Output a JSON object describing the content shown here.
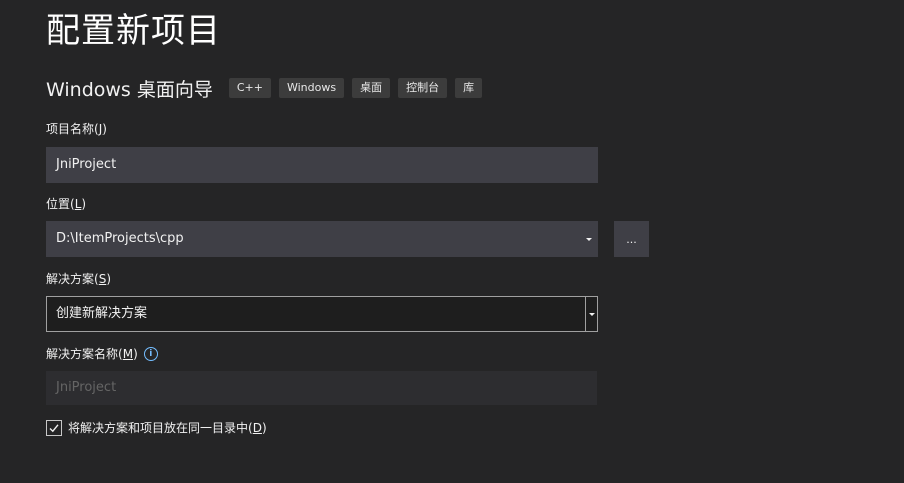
{
  "page": {
    "title": "配置新项目"
  },
  "template": {
    "name": "Windows 桌面向导",
    "tags": [
      "C++",
      "Windows",
      "桌面",
      "控制台",
      "库"
    ]
  },
  "project_name": {
    "label": "项目名称",
    "mnemonic": "J",
    "value": "JniProject"
  },
  "location": {
    "label": "位置",
    "mnemonic": "L",
    "value": "D:\\ItemProjects\\cpp",
    "browse_label": "..."
  },
  "solution": {
    "label": "解决方案",
    "mnemonic": "S",
    "selected": "创建新解决方案"
  },
  "solution_name": {
    "label": "解决方案名称",
    "mnemonic": "M",
    "value": "JniProject",
    "info_icon": "info-icon"
  },
  "same_dir": {
    "label": "将解决方案和项目放在同一目录中",
    "mnemonic": "D",
    "checked": true
  },
  "colors": {
    "background": "#252526",
    "field": "#3f3f46",
    "accent": "#75beff"
  }
}
